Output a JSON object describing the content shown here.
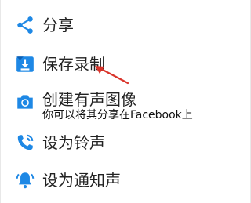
{
  "menu": {
    "items": [
      {
        "label": "分享",
        "icon": "share-icon"
      },
      {
        "label": "保存录制",
        "icon": "save-download-icon"
      },
      {
        "label": "创建有声图像",
        "sublabel": "你可以将其分享在Facebook上",
        "icon": "camera-icon"
      },
      {
        "label": "设为铃声",
        "icon": "phone-ring-icon"
      },
      {
        "label": "设为通知声",
        "icon": "bell-notification-icon"
      }
    ]
  },
  "colors": {
    "icon_blue": "#1e88e5",
    "annotation_red": "#d9342b"
  }
}
